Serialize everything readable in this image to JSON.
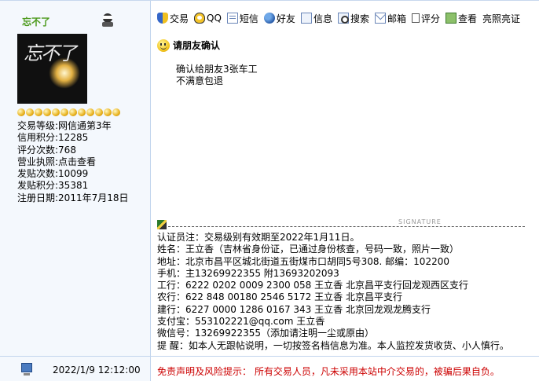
{
  "user": {
    "name": "忘不了",
    "avatar_text": "忘不了",
    "star_count": 12,
    "stats": [
      {
        "label": "交易等级:",
        "value": "网信通第3年"
      },
      {
        "label": "信用积分:",
        "value": "12285"
      },
      {
        "label": "评分次数:",
        "value": "768"
      },
      {
        "label": "营业执照:",
        "value": "点击查看"
      },
      {
        "label": "发贴次数:",
        "value": "10099"
      },
      {
        "label": "发贴积分:",
        "value": "35381"
      },
      {
        "label": "注册日期:",
        "value": "2011年7月18日"
      }
    ]
  },
  "toolbar": {
    "items": [
      {
        "label": "交易",
        "icon": "shield-icon"
      },
      {
        "label": "QQ",
        "icon": "qq-icon"
      },
      {
        "label": "短信",
        "icon": "message-icon"
      },
      {
        "label": "好友",
        "icon": "friend-icon"
      },
      {
        "label": "信息",
        "icon": "info-icon"
      },
      {
        "label": "搜索",
        "icon": "search-icon"
      },
      {
        "label": "邮箱",
        "icon": "mail-icon"
      },
      {
        "label": "评分",
        "icon": "rate-icon"
      },
      {
        "label": "查看",
        "icon": "view-icon"
      }
    ],
    "bright_label": "亮照亮证"
  },
  "post": {
    "title": "请朋友确认",
    "lines": [
      "确认给朋友3张车工",
      "不满意包退"
    ]
  },
  "signature": {
    "marker": "SIGNATURE",
    "lines": [
      "认证员注：交易级别有效期至2022年1月11日。",
      "姓名：王立香（吉林省身份证，已通过身份核查，号码一致，照片一致）",
      "地址：北京市昌平区城北街道五街煤市口胡同5号308.     邮编：102200",
      "手机：主13269922355  附13693202093",
      "工行：6222 0202 0009 2300 058 王立香   北京昌平支行回龙观西区支行",
      "农行：622 848 00180 2546 5172 王立香   北京昌平支行",
      "建行：6227 0000 1286 0167 343 王立香   北京回龙观龙腾支行",
      "支付宝：553102221@qq.com          王立香",
      "微信号：13269922355（添加请注明一尘或原由）",
      "提   醒：如本人无跟帖说明，一切按签名档信息为准。本人监控发货收货、小人慎行。"
    ]
  },
  "footer": {
    "time": "2022/1/9 12:12:00",
    "disclaimer": "免责声明及风险提示：  所有交易人员，凡未采用本站中介交易的，被骗后果自负。"
  }
}
